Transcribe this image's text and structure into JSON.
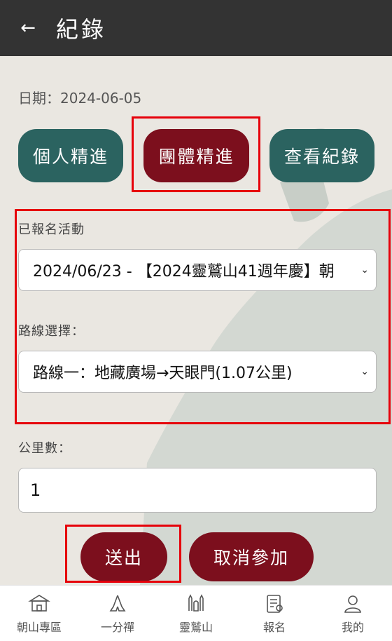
{
  "header": {
    "title": "紀錄"
  },
  "date": {
    "label": "日期：",
    "value": "2024-06-05"
  },
  "mode_buttons": {
    "personal": "個人精進",
    "group": "團體精進",
    "view": "查看紀錄"
  },
  "form": {
    "event_label": "已報名活動",
    "event_value": "2024/06/23 - 【2024靈鷲山41週年慶】朝",
    "route_label": "路線選擇：",
    "route_value": "路線一：地藏廣場→天眼門(1.07公里)",
    "distance_label": "公里數：",
    "distance_value": "1"
  },
  "actions": {
    "submit": "送出",
    "cancel": "取消參加"
  },
  "tabs": [
    {
      "label": "朝山專區",
      "icon": "temple-icon"
    },
    {
      "label": "一分禪",
      "icon": "praying-hands-icon"
    },
    {
      "label": "靈鷲山",
      "icon": "mountain-icon"
    },
    {
      "label": "報名",
      "icon": "registration-form-icon"
    },
    {
      "label": "我的",
      "icon": "user-icon"
    }
  ],
  "colors": {
    "header_bg": "#333333",
    "teal_button": "#2b6360",
    "red_button": "#7c0f1d",
    "highlight": "#e6000a"
  }
}
